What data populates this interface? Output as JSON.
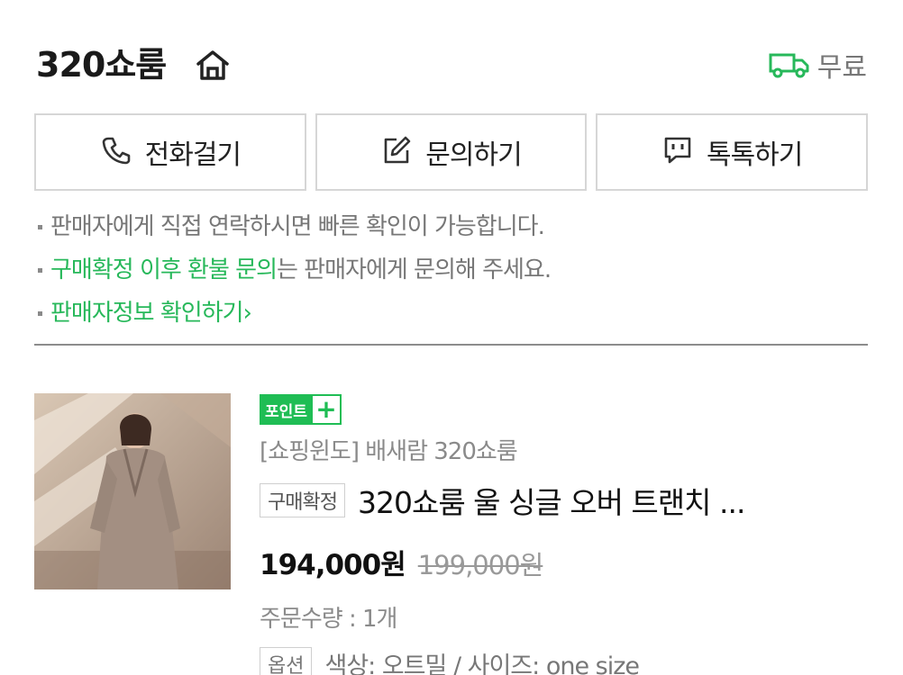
{
  "store": {
    "name": "320쇼룸",
    "shipping_label": "무료"
  },
  "actions": [
    {
      "label": "전화걸기",
      "icon": "phone-icon"
    },
    {
      "label": "문의하기",
      "icon": "edit-icon"
    },
    {
      "label": "톡톡하기",
      "icon": "chat-icon"
    }
  ],
  "notices": {
    "line1": "판매자에게 직접 연락하시면 빠른 확인이 가능합니다.",
    "line2_highlight": "구매확정 이후 환불 문의",
    "line2_rest": "는 판매자에게 문의해 주세요.",
    "line3_link": "판매자정보 확인하기",
    "line3_chevron": "›"
  },
  "product": {
    "point_badge": "포인트",
    "point_plus": "+",
    "shop": "[쇼핑윈도] 배새람 320쇼룸",
    "status_badge": "구매확정",
    "title": "320쇼룸 울 싱글 오버 트랜치 ...",
    "price": "194,000원",
    "original_price": "199,000원",
    "quantity": "주문수량 : 1개",
    "option_badge": "옵션",
    "option_text": "색상: 오트밀 / 사이즈: one size"
  },
  "colors": {
    "accent_green": "#27b85a",
    "badge_green": "#1fbd54"
  }
}
